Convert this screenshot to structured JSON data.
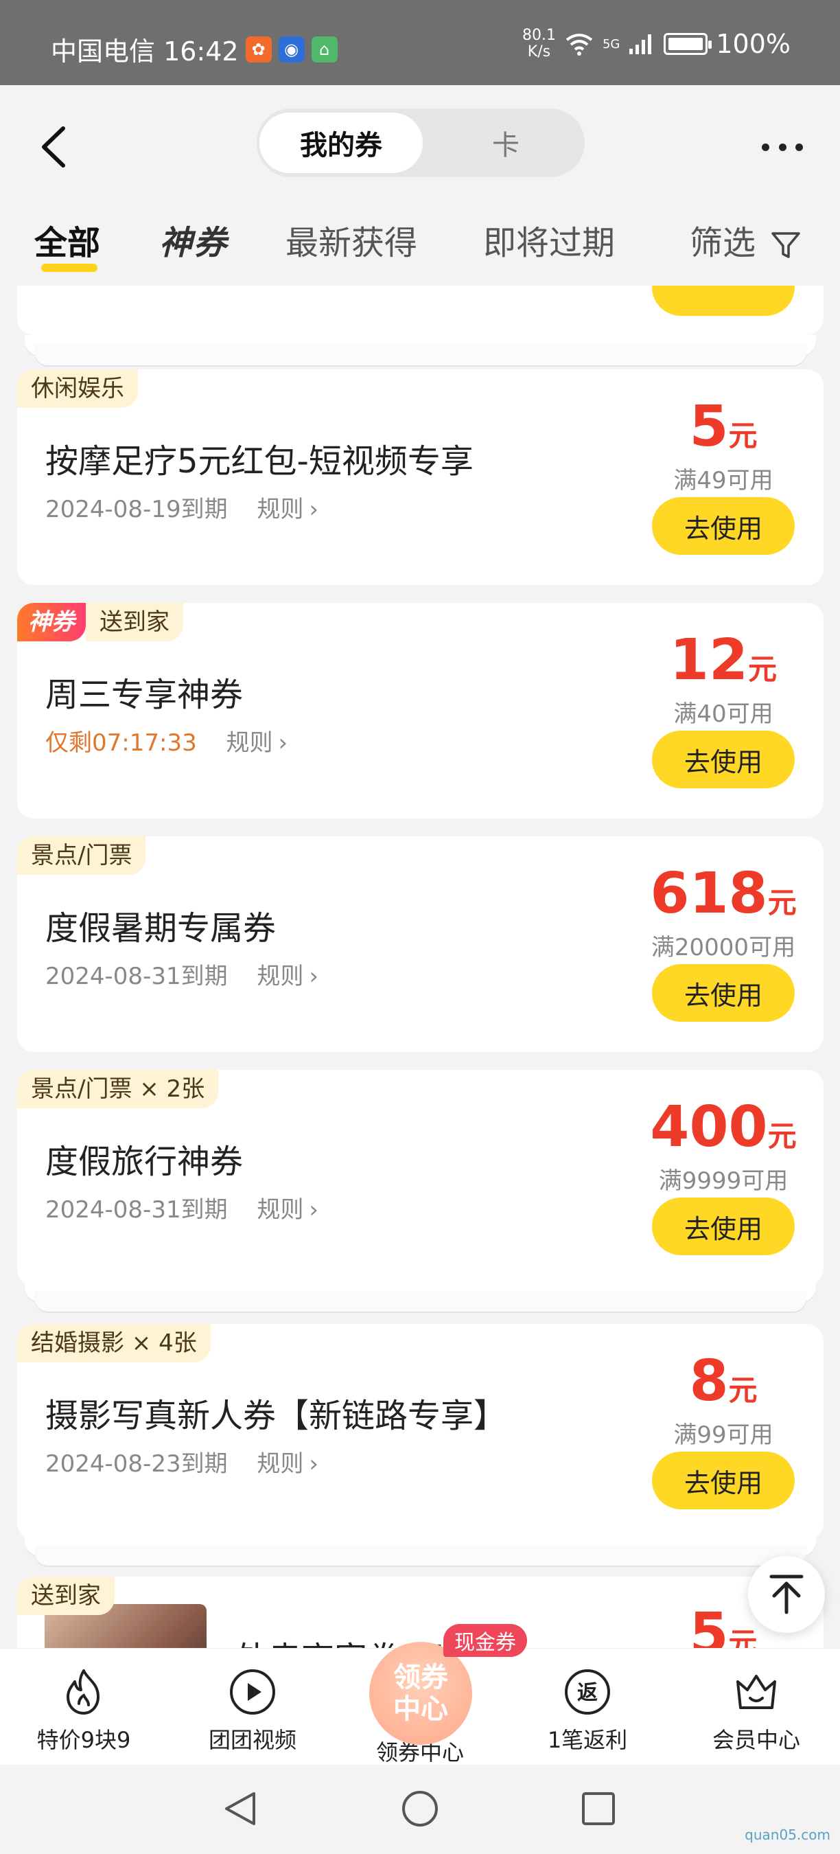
{
  "status_bar": {
    "carrier_time": "中国电信 16:42",
    "net_speed_value": "80.1",
    "net_speed_unit": "K/s",
    "signal": "5G",
    "battery": "100%",
    "battery_level": 1.0
  },
  "header": {
    "segment_active": "我的券",
    "segment_other": "卡"
  },
  "tabs": {
    "all": "全部",
    "shen": "神券",
    "newest": "最新获得",
    "expiring": "即将过期",
    "filter": "筛选"
  },
  "coupons": [
    {
      "tag": "休闲娱乐",
      "title": "按摩足疗5元红包-短视频专享",
      "expiry": "2024-08-19到期",
      "rules": "规则",
      "amount": "5",
      "unit": "元",
      "condition": "满49可用",
      "button": "去使用"
    },
    {
      "tag_shen": "神券",
      "tag": "送到家",
      "title": "周三专享神券",
      "expiry": "仅剩07:17:33",
      "rules": "规则",
      "amount": "12",
      "unit": "元",
      "condition": "满40可用",
      "button": "去使用"
    },
    {
      "tag": "景点/门票",
      "title": "度假暑期专属券",
      "expiry": "2024-08-31到期",
      "rules": "规则",
      "amount": "618",
      "unit": "元",
      "condition": "满20000可用",
      "button": "去使用"
    },
    {
      "tag": "景点/门票 × 2张",
      "title": "度假旅行神券",
      "expiry": "2024-08-31到期",
      "rules": "规则",
      "amount": "400",
      "unit": "元",
      "condition": "满9999可用",
      "button": "去使用"
    },
    {
      "tag": "结婚摄影 × 4张",
      "title": "摄影写真新人券【新链路专享】",
      "expiry": "2024-08-23到期",
      "rules": "规则",
      "amount": "8",
      "unit": "元",
      "condition": "满99可用",
      "button": "去使用"
    },
    {
      "tag": "送到家",
      "title": "外卖商家券 开张店",
      "amount": "5",
      "unit": "元"
    }
  ],
  "bottom_nav": {
    "item1": "特价9块9",
    "item2": "团团视频",
    "center_line1": "领券",
    "center_line2": "中心",
    "center_badge": "现金券",
    "item3": "领券中心",
    "item4_icon_text": "返",
    "item4": "1笔返利",
    "item5": "会员中心"
  },
  "watermark": "quan05.com",
  "colors": {
    "accent_yellow": "#ffd826",
    "price_red": "#ee3b29",
    "tag_bg": "#fff3d6",
    "countdown_orange": "#e0772a"
  }
}
